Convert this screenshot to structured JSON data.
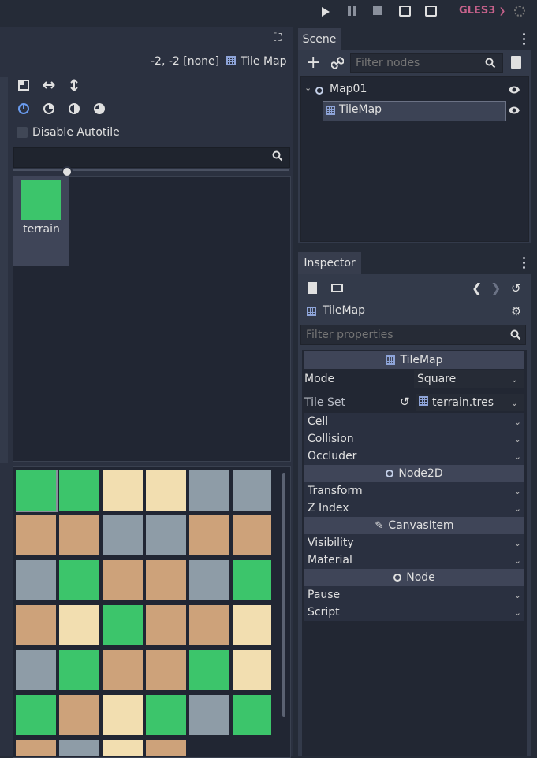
{
  "topbar": {
    "renderer": "GLES3"
  },
  "editor": {
    "coords": "-2, -2 [none]",
    "node_type": "Tile Map",
    "disable_autotile_label": "Disable Autotile",
    "tile_name": "terrain"
  },
  "scene": {
    "tab": "Scene",
    "filter_placeholder": "Filter nodes",
    "nodes": [
      "Map01",
      "TileMap"
    ]
  },
  "inspector": {
    "tab": "Inspector",
    "object_name": "TileMap",
    "filter_placeholder": "Filter properties",
    "sections": {
      "tilemap": "TileMap",
      "node2d": "Node2D",
      "canvasitem": "CanvasItem",
      "node": "Node"
    },
    "props": {
      "mode_label": "Mode",
      "mode_value": "Square",
      "tileset_label": "Tile Set",
      "tileset_value": "terrain.tres",
      "cell": "Cell",
      "collision": "Collision",
      "occluder": "Occluder",
      "transform": "Transform",
      "zindex": "Z Index",
      "visibility": "Visibility",
      "material": "Material",
      "pause": "Pause",
      "script": "Script"
    }
  },
  "colors": {
    "grass": "#3cc56b",
    "sand": "#f2deb0",
    "road": "#8e9ca7",
    "dirt": "#cda27a"
  }
}
